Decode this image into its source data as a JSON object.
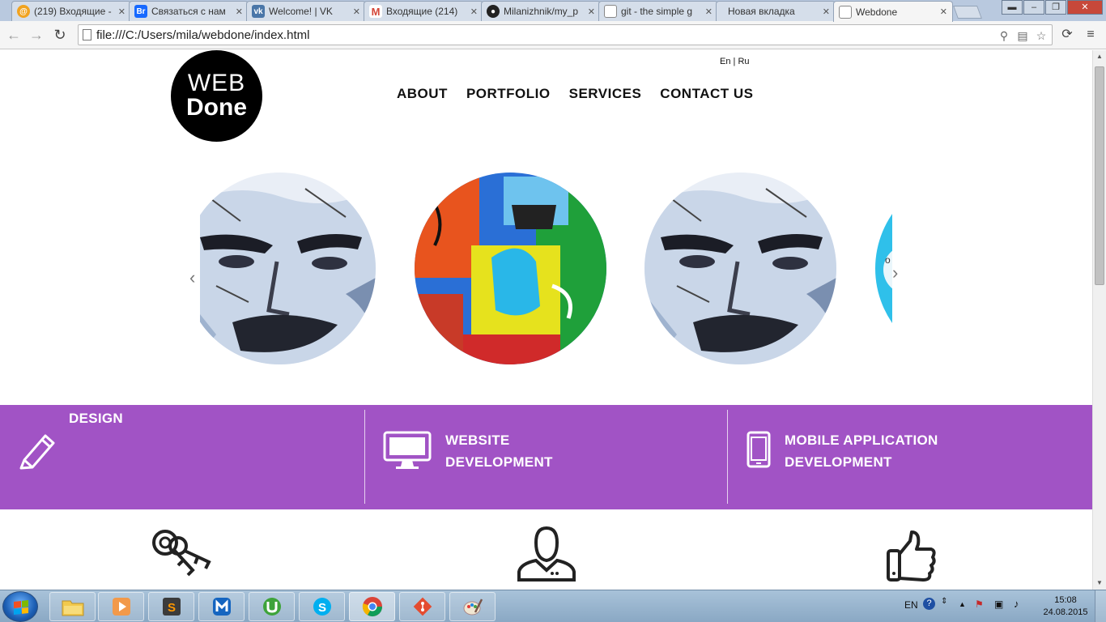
{
  "browser": {
    "tabs": [
      {
        "title": "(219) Входящие -",
        "favicon": "mail-ru-icon",
        "color": "#3d8fd0",
        "active": false
      },
      {
        "title": "Связаться с нам",
        "favicon": "behance-icon",
        "color": "#1769ff",
        "active": false
      },
      {
        "title": "Welcome! | VK",
        "favicon": "vk-icon",
        "color": "#4a76a8",
        "active": false
      },
      {
        "title": "Входящие (214)",
        "favicon": "gmail-icon",
        "color": "#d44638",
        "active": false
      },
      {
        "title": "Milanizhnik/my_p",
        "favicon": "github-icon",
        "color": "#222222",
        "active": false
      },
      {
        "title": "git - the simple g",
        "favicon": "page-icon",
        "color": "#888888",
        "active": false
      },
      {
        "title": "Новая вкладка",
        "favicon": "none",
        "color": "#888888",
        "active": false
      },
      {
        "title": "Webdone",
        "favicon": "page-icon",
        "color": "#888888",
        "active": true
      }
    ],
    "url": "file:///C:/Users/mila/webdone/index.html"
  },
  "site": {
    "logo": {
      "line1": "WEB",
      "line2": "Done"
    },
    "lang": {
      "en": "En",
      "sep": "|",
      "ru": "Ru"
    },
    "nav": [
      "ABOUT",
      "PORTFOLIO",
      "SERVICES",
      "CONTACT US"
    ],
    "carousel": {
      "prev_icon": "chevron-left-icon",
      "next_icon": "chevron-right-icon"
    },
    "services": [
      {
        "line1": "DESIGN",
        "line2": "",
        "icon": "pencil-icon"
      },
      {
        "line1": "WEBSITE",
        "line2": "DEVELOPMENT",
        "icon": "monitor-icon"
      },
      {
        "line1": "MOBILE APPLICATION",
        "line2": "DEVELOPMENT",
        "icon": "smartphone-icon"
      }
    ],
    "features_icons": [
      "keys-icon",
      "person-icon",
      "thumbs-up-icon"
    ],
    "accent_color": "#a153c5"
  },
  "taskbar": {
    "lang": "EN",
    "time": "15:08",
    "date": "24.08.2015",
    "apps": [
      "explorer-icon",
      "media-player-icon",
      "sublime-text-icon",
      "maxthon-icon",
      "utorrent-icon",
      "skype-icon",
      "chrome-icon",
      "git-icon",
      "paint-icon"
    ]
  }
}
